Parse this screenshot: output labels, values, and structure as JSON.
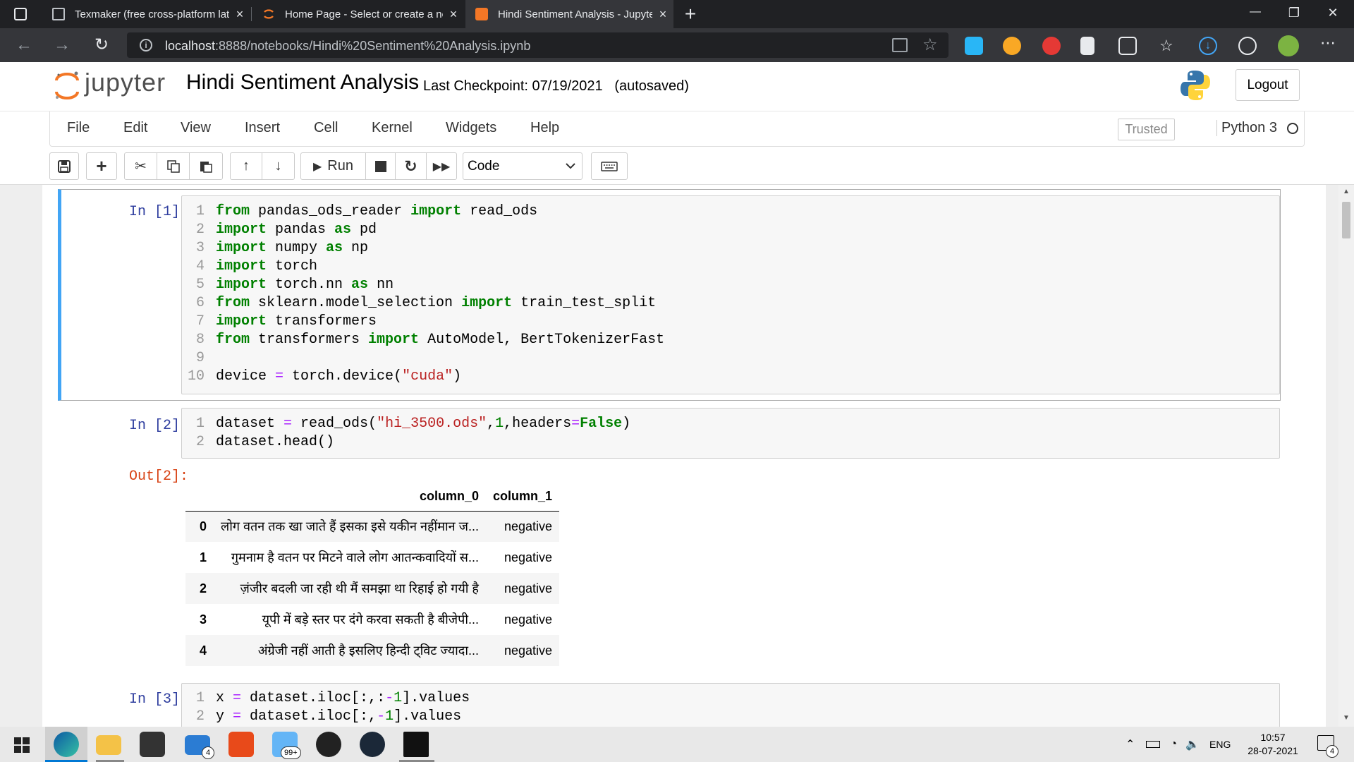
{
  "browser": {
    "tabs": [
      {
        "title": "Texmaker (free cross-platform latex editor)",
        "active": false
      },
      {
        "title": "Home Page - Select or create a notebook",
        "active": false
      },
      {
        "title": "Hindi Sentiment Analysis - Jupyter Notebook",
        "active": true
      }
    ],
    "new_tab": "+",
    "url_host": "localhost",
    "url_rest": ":8888/notebooks/Hindi%20Sentiment%20Analysis.ipynb",
    "window_controls": {
      "minimize": "—",
      "maximize": "❐",
      "close": "✕"
    }
  },
  "jupyter": {
    "logo_text": "jupyter",
    "notebook_title": "Hindi Sentiment Analysis",
    "checkpoint": "Last Checkpoint: 07/19/2021",
    "autosaved": "(autosaved)",
    "logout": "Logout"
  },
  "menu": {
    "items": [
      "File",
      "Edit",
      "View",
      "Insert",
      "Cell",
      "Kernel",
      "Widgets",
      "Help"
    ],
    "trusted": "Trusted",
    "kernel": "Python 3"
  },
  "toolbar": {
    "run": "Run",
    "cell_type": "Code"
  },
  "cells": {
    "c1": {
      "prompt": "In [1]:",
      "lines": [
        "1",
        "2",
        "3",
        "4",
        "5",
        "6",
        "7",
        "8",
        "9",
        "10"
      ]
    },
    "c2": {
      "prompt": "In [2]:",
      "out_prompt": "Out[2]:",
      "table": {
        "columns": [
          "column_0",
          "column_1"
        ],
        "rows": [
          {
            "index": "0",
            "column_0": "लोग वतन तक खा जाते हैं इसका इसे यकीन नहींमान ज...",
            "column_1": "negative"
          },
          {
            "index": "1",
            "column_0": "गुमनाम है वतन पर मिटने वाले लोग आतन्कवादियों स...",
            "column_1": "negative"
          },
          {
            "index": "2",
            "column_0": "ज़ंजीर बदली जा रही थी मैं समझा था रिहाई हो गयी है",
            "column_1": "negative"
          },
          {
            "index": "3",
            "column_0": "यूपी में बड़े स्तर पर दंगे करवा सकती है बीजेपी...",
            "column_1": "negative"
          },
          {
            "index": "4",
            "column_0": "अंग्रेजी नहीं आती है इसलिए हिन्दी ट्विट ज्यादा...",
            "column_1": "negative"
          }
        ]
      }
    },
    "c3": {
      "prompt": "In [3]:"
    }
  },
  "taskbar": {
    "mail_badge": "4",
    "folder_badge": "99+",
    "language": "ENG",
    "time": "10:57",
    "date": "28-07-2021",
    "notifications": "4"
  },
  "colors": {
    "selected_cell": "#42a5f5",
    "prompt_in": "#303f9f",
    "prompt_out": "#d84315",
    "keyword": "#008000",
    "string": "#ba2121"
  }
}
